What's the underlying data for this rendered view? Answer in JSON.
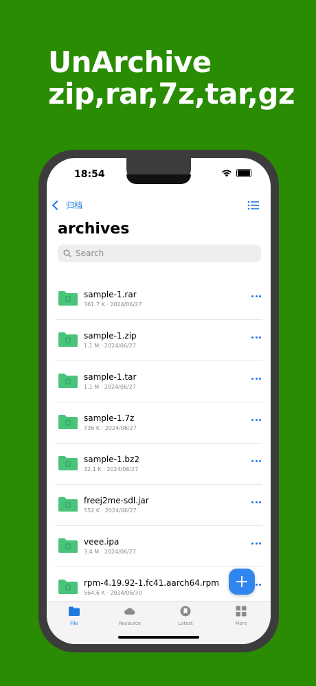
{
  "headline": {
    "line1": "UnArchive",
    "line2": "zip,rar,7z,tar,gz"
  },
  "status": {
    "time": "18:54"
  },
  "nav": {
    "back_label": "归档"
  },
  "page": {
    "title": "archives"
  },
  "search": {
    "placeholder": "Search"
  },
  "files": [
    {
      "name": "sample-1.rar",
      "meta": "361.7 K · 2024/06/27"
    },
    {
      "name": "sample-1.zip",
      "meta": "1.1 M · 2024/06/27"
    },
    {
      "name": "sample-1.tar",
      "meta": "1.1 M · 2024/06/27"
    },
    {
      "name": "sample-1.7z",
      "meta": "736 K · 2024/06/27"
    },
    {
      "name": "sample-1.bz2",
      "meta": "32.1 K · 2024/06/27"
    },
    {
      "name": "freej2me-sdl.jar",
      "meta": "552 K · 2024/06/27"
    },
    {
      "name": "veee.ipa",
      "meta": "3.4 M · 2024/06/27"
    },
    {
      "name": "rpm-4.19.92-1.fc41.aarch64.rpm",
      "meta": "564.6 K · 2024/06/30"
    }
  ],
  "tabs": [
    {
      "label": "File"
    },
    {
      "label": "Resource"
    },
    {
      "label": "Latest"
    },
    {
      "label": "More"
    }
  ],
  "colors": {
    "background": "#2a8c02",
    "accent": "#1f7ae0",
    "folder": "#49c47a"
  }
}
